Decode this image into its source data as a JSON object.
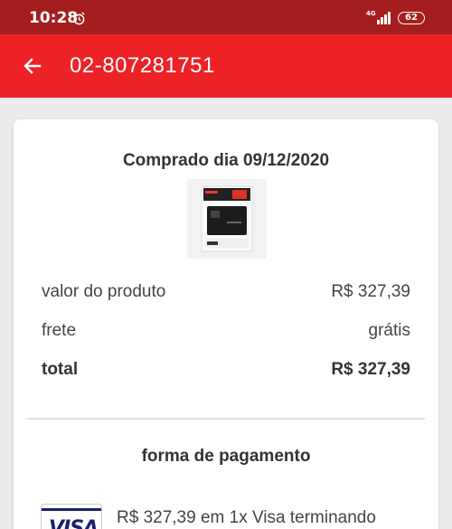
{
  "status_bar": {
    "time": "10:28",
    "network": "4G",
    "battery": "62"
  },
  "header": {
    "title": "02-807281751"
  },
  "order": {
    "purchase_date": "Comprado dia 09/12/2020",
    "product_value_label": "valor do produto",
    "product_value": "R$ 327,39",
    "shipping_label": "frete",
    "shipping_value": "grátis",
    "total_label": "total",
    "total_value": "R$ 327,39"
  },
  "payment": {
    "title": "forma de pagamento",
    "card_brand": "VISA",
    "description": "R$ 327,39 em 1x Visa terminando"
  },
  "colors": {
    "status_bar": "#a51e1e",
    "app_bar": "#ed2227",
    "background": "#ebebeb"
  }
}
